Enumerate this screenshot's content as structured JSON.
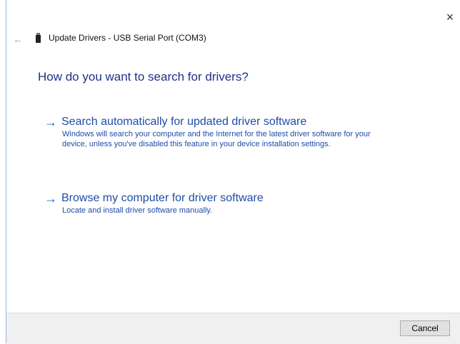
{
  "dialog": {
    "title": "Update Drivers - USB Serial Port (COM3)",
    "close_glyph": "×",
    "back_glyph": "←",
    "heading": "How do you want to search for drivers?"
  },
  "options": [
    {
      "arrow": "→",
      "title": "Search automatically for updated driver software",
      "description": "Windows will search your computer and the Internet for the latest driver software for your device, unless you've disabled this feature in your device installation settings."
    },
    {
      "arrow": "→",
      "title": "Browse my computer for driver software",
      "description": "Locate and install driver software manually."
    }
  ],
  "footer": {
    "cancel_label": "Cancel"
  },
  "colors": {
    "link": "#1e4ca8",
    "heading": "#1e3287",
    "arrow": "#0066cc"
  },
  "icons": {
    "device": "usb-device-icon",
    "close": "close-icon",
    "back": "back-arrow-icon"
  }
}
